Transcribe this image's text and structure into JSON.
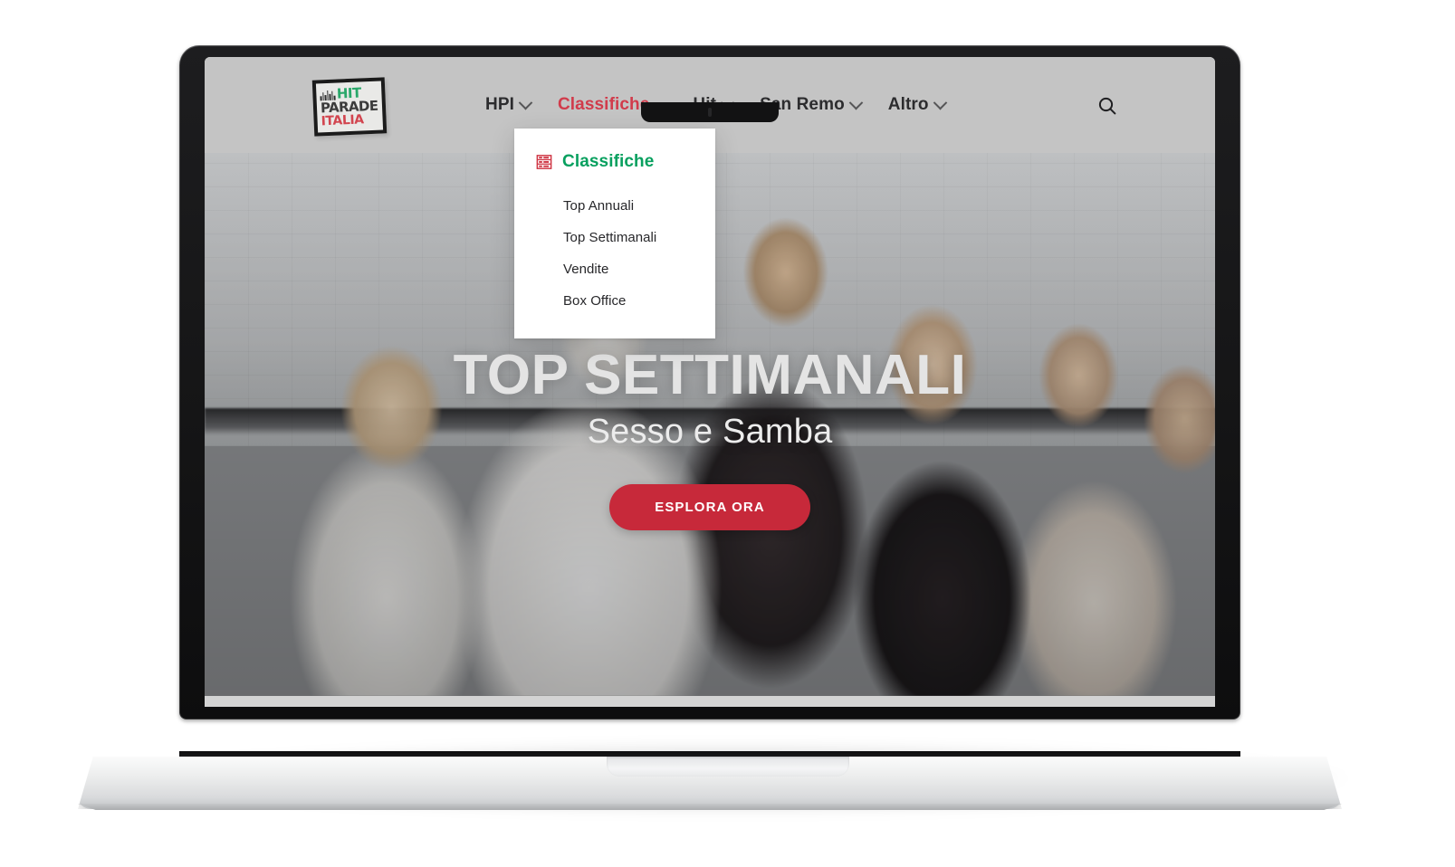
{
  "site": {
    "logo": {
      "line1": "HIT",
      "line2": "PARADE",
      "line3": "ITALIA",
      "color_green": "#2aa86a",
      "color_dark": "#3b3b3b",
      "color_red": "#d2454f"
    },
    "nav": [
      {
        "label": "HPI",
        "icon": "chevron-down-icon",
        "active": false
      },
      {
        "label": "Classifiche",
        "icon": "chevron-up-icon",
        "active": true
      },
      {
        "label": "Hit",
        "icon": "chevron-down-icon",
        "active": false
      },
      {
        "label": "San Remo",
        "icon": "chevron-down-icon",
        "active": false
      },
      {
        "label": "Altro",
        "icon": "chevron-down-icon",
        "active": false
      }
    ],
    "search": {
      "icon": "search-icon"
    },
    "accent_red": "#d13b4b",
    "header_bg": "#c4c4c4"
  },
  "dropdown": {
    "open": true,
    "heading": "Classifiche",
    "heading_icon": "chart-table-icon",
    "heading_color": "#08a05f",
    "icon_color": "#cf3443",
    "items": [
      {
        "label": "Top Annuali"
      },
      {
        "label": "Top Settimanali"
      },
      {
        "label": "Vendite"
      },
      {
        "label": "Box Office"
      }
    ]
  },
  "hero": {
    "title": "TOP SETTIMANALI",
    "subtitle": "Sesso e Samba",
    "cta_label": "ESPLORA ORA",
    "cta_color": "#c7293a",
    "title_color": "#e4e4e4"
  }
}
